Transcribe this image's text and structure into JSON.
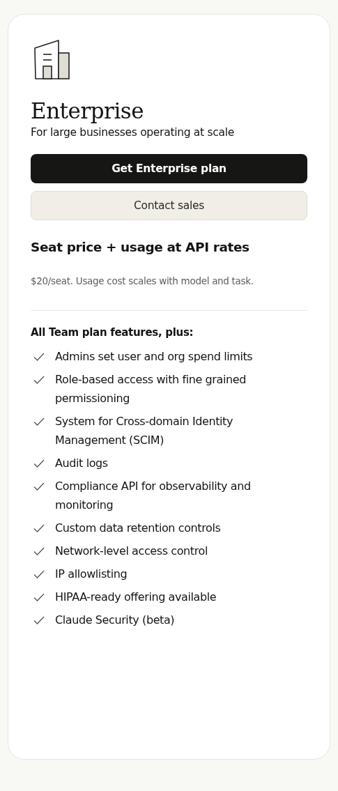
{
  "plan": {
    "name": "Enterprise",
    "tagline": "For large businesses operating at scale"
  },
  "buttons": [
    {
      "label": "Get Enterprise plan",
      "kind": "primary"
    },
    {
      "label": "Contact sales",
      "kind": "secondary"
    }
  ],
  "pricing": {
    "headline": "Seat price + usage at API rates",
    "note": "$20/seat. Usage cost scales with model and task."
  },
  "features": {
    "heading": "All Team plan features, plus:",
    "items": [
      "Admins set user and org spend limits",
      "Role-based access with fine grained permissioning",
      "System for Cross-domain Identity Management (SCIM)",
      "Audit logs",
      "Compliance API for observability and monitoring",
      "Custom data retention controls",
      "Network-level access control",
      "IP allowlisting",
      "HIPAA-ready offering available",
      "Claude Security (beta)"
    ]
  }
}
